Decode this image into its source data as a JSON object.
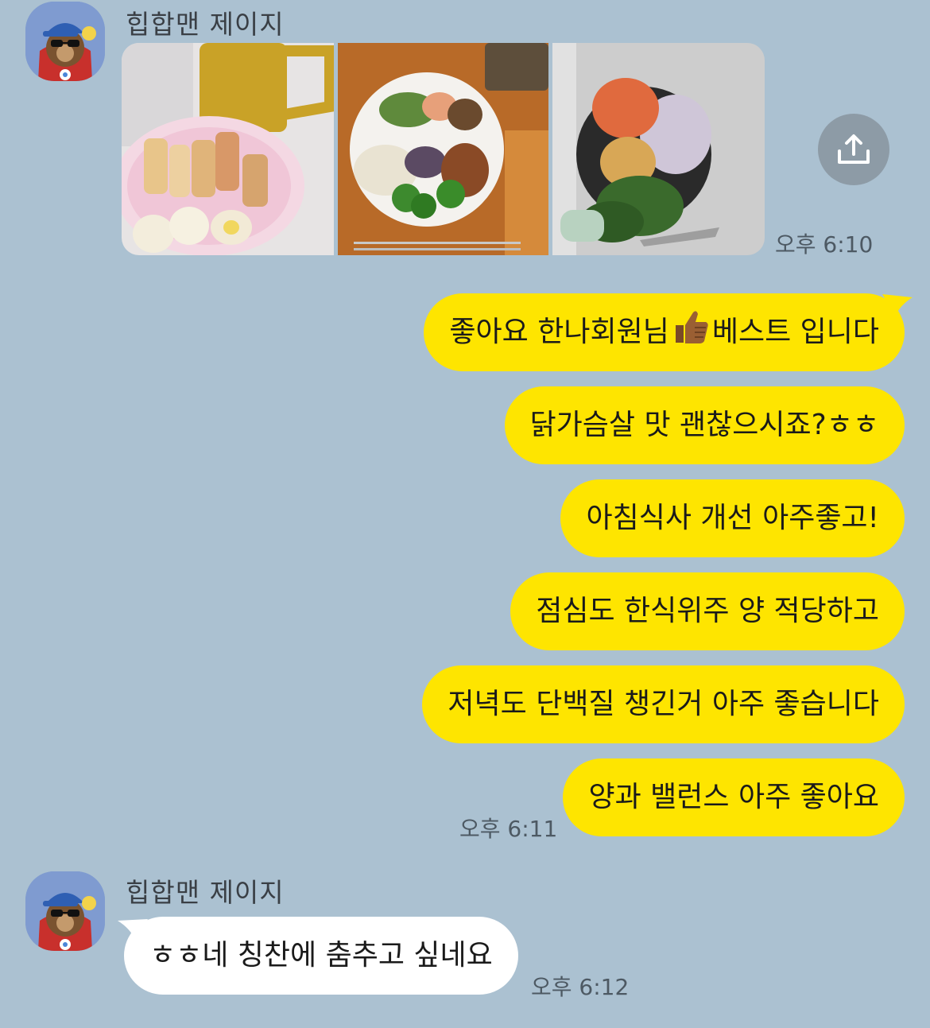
{
  "messages": {
    "first_group": {
      "sender": "힙합맨 제이지",
      "time": "오후 6:10",
      "photos": [
        "breakfast-photo",
        "lunch-photo",
        "dinner-photo"
      ]
    },
    "outgoing": {
      "bubbles": [
        {
          "before": "좋아요 한나회원님",
          "after": "베스트 입니다"
        },
        {
          "text": "닭가슴살 맛 괜찮으시죠?ㅎㅎ"
        },
        {
          "text": "아침식사 개선 아주좋고!"
        },
        {
          "text": "점심도 한식위주 양 적당하고"
        },
        {
          "text": "저녁도 단백질 챙긴거 아주 좋습니다"
        },
        {
          "text": "양과 밸런스 아주 좋아요"
        }
      ],
      "time": "오후 6:11"
    },
    "second_group": {
      "sender": "힙합맨 제이지",
      "text": "ㅎㅎ네 칭찬에 춤추고 싶네요",
      "time": "오후 6:12"
    }
  },
  "icons": {
    "share": "share-icon",
    "thumbs_up": "thumbs-up-emoji"
  },
  "colors": {
    "background": "#abc1d1",
    "outgoing_bubble": "#fee500",
    "incoming_bubble": "#ffffff",
    "share_button": "#8d9ba6"
  }
}
